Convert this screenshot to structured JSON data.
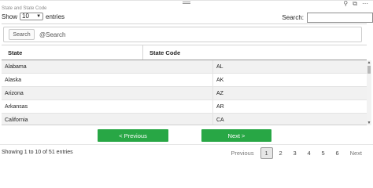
{
  "visual_title": "State and State Code",
  "top_icons": [
    "pin-icon",
    "expand-icon",
    "more-icon"
  ],
  "length": {
    "show_label": "Show",
    "selected": "10",
    "entries_label": "entries"
  },
  "search_top": {
    "label": "Search:"
  },
  "search_bar": {
    "button_label": "Search",
    "placeholder": "@Search"
  },
  "table": {
    "headers": [
      "State",
      "State Code"
    ],
    "rows": [
      {
        "state": "Alabama",
        "code": "AL"
      },
      {
        "state": "Alaska",
        "code": "AK"
      },
      {
        "state": "Arizona",
        "code": "AZ"
      },
      {
        "state": "Arkansas",
        "code": "AR"
      },
      {
        "state": "California",
        "code": "CA"
      }
    ]
  },
  "nav": {
    "previous_label": "< Previous",
    "next_label": "Next >"
  },
  "info": "Showing 1 to 10 of 51 entries",
  "pager": {
    "previous": "Previous",
    "pages": [
      "1",
      "2",
      "3",
      "4",
      "5",
      "6"
    ],
    "active": "1",
    "next": "Next"
  },
  "colors": {
    "accent_green": "#28a745",
    "row_alt": "#f1f1f1"
  }
}
